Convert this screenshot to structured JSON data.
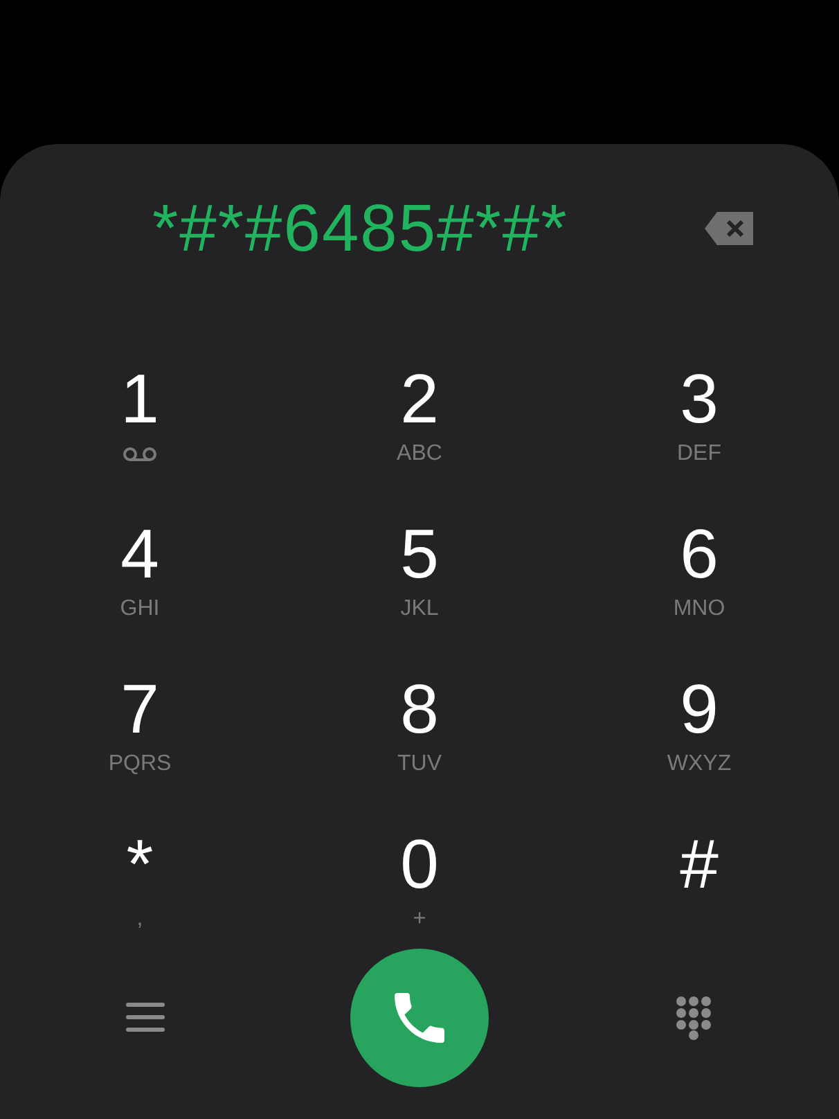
{
  "display": {
    "number": "*#*#6485#*#*"
  },
  "keys": [
    {
      "digit": "1",
      "kind": "voicemail"
    },
    {
      "digit": "2",
      "kind": "letters",
      "letters": "ABC"
    },
    {
      "digit": "3",
      "kind": "letters",
      "letters": "DEF"
    },
    {
      "digit": "4",
      "kind": "letters",
      "letters": "GHI"
    },
    {
      "digit": "5",
      "kind": "letters",
      "letters": "JKL"
    },
    {
      "digit": "6",
      "kind": "letters",
      "letters": "MNO"
    },
    {
      "digit": "7",
      "kind": "letters",
      "letters": "PQRS"
    },
    {
      "digit": "8",
      "kind": "letters",
      "letters": "TUV"
    },
    {
      "digit": "9",
      "kind": "letters",
      "letters": "WXYZ"
    },
    {
      "digit": "*",
      "kind": "letters",
      "letters": ","
    },
    {
      "digit": "0",
      "kind": "letters",
      "letters": "+"
    },
    {
      "digit": "#",
      "kind": "none"
    }
  ]
}
